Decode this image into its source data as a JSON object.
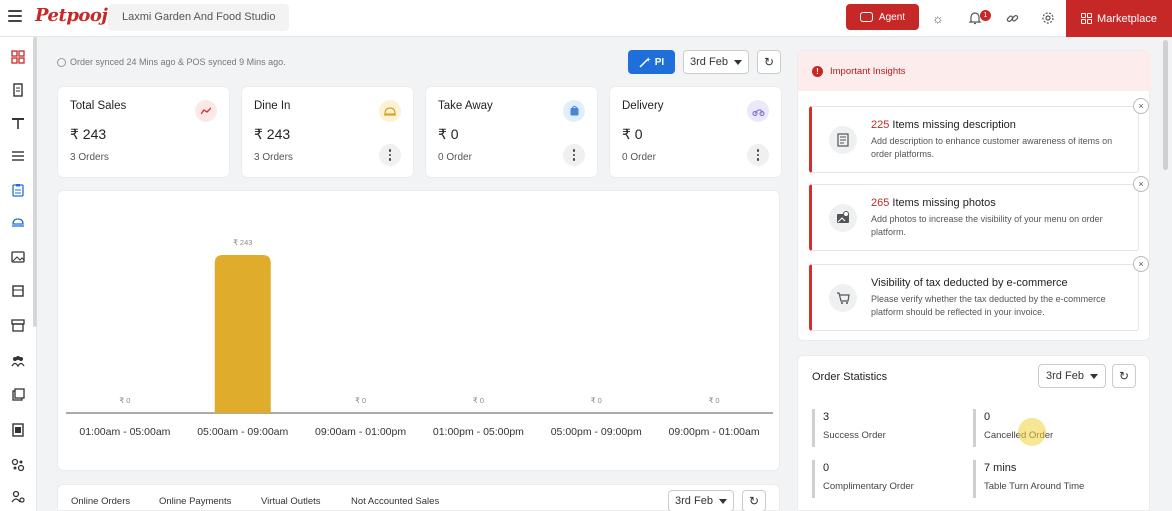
{
  "header": {
    "logo": "Petpooja",
    "outlet_name": "Laxmi Garden And Food Studio",
    "agent_label": "Agent",
    "notification_count": "1",
    "marketplace_label": "Marketplace"
  },
  "sync_text": "Order synced 24 Mins ago & POS synced 9 Mins ago.",
  "controls": {
    "pi_label": "PI",
    "date": "3rd Feb"
  },
  "cards": [
    {
      "title": "Total Sales",
      "value": "₹ 243",
      "sub": "3 Orders",
      "icon": "trend-icon"
    },
    {
      "title": "Dine In",
      "value": "₹ 243",
      "sub": "3 Orders",
      "icon": "cloche-icon"
    },
    {
      "title": "Take Away",
      "value": "₹ 0",
      "sub": "0 Order",
      "icon": "bag-icon"
    },
    {
      "title": "Delivery",
      "value": "₹ 0",
      "sub": "0 Order",
      "icon": "scooter-icon"
    }
  ],
  "chart_data": {
    "type": "bar",
    "categories": [
      "01:00am - 05:00am",
      "05:00am - 09:00am",
      "09:00am - 01:00pm",
      "01:00pm - 05:00pm",
      "05:00pm - 09:00pm",
      "09:00pm - 01:00am"
    ],
    "values": [
      0,
      243,
      0,
      0,
      0,
      0
    ],
    "value_labels": [
      "₹ 0",
      "₹ 243",
      "₹ 0",
      "₹ 0",
      "₹ 0",
      "₹ 0"
    ],
    "bar_color": "#e0ac2c",
    "grid": false
  },
  "bottom_tabs": [
    "Online Orders",
    "Online Payments",
    "Virtual Outlets",
    "Not Accounted Sales"
  ],
  "bottom_date": "3rd Feb",
  "insights": {
    "title": "Important Insights",
    "items": [
      {
        "count": "225",
        "title": " Items missing description",
        "desc": "Add description to enhance customer awareness of items on order platforms."
      },
      {
        "count": "265",
        "title": " Items missing photos",
        "desc": "Add photos to increase the visibility of your menu on order platform."
      },
      {
        "count": "",
        "title": "Visibility of tax deducted by e-commerce",
        "desc": "Please verify whether the tax deducted by the e-commerce platform should be reflected in your invoice."
      }
    ]
  },
  "order_statistics": {
    "title": "Order Statistics",
    "date": "3rd Feb",
    "items": [
      {
        "value": "3",
        "label": "Success Order"
      },
      {
        "value": "0",
        "label": "Cancelled Order"
      },
      {
        "value": "0",
        "label": "Complimentary Order"
      },
      {
        "value": "7 mins",
        "label": "Table Turn Around Time"
      }
    ]
  },
  "colors": {
    "brand": "#c62828",
    "accent_blue": "#1e6fd9",
    "bar": "#e0ac2c"
  }
}
